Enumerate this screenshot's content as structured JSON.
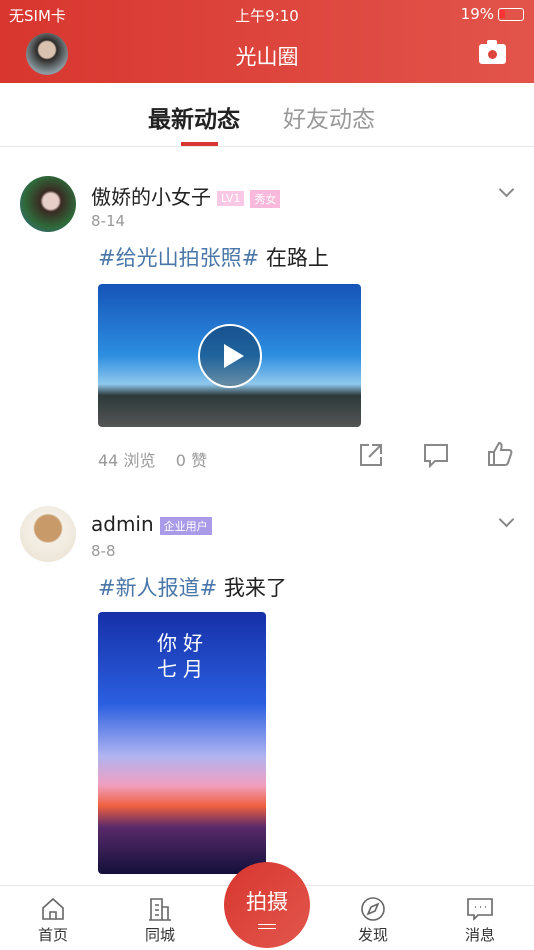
{
  "status": {
    "carrier": "无SIM卡",
    "time": "上午9:10",
    "battery": "19%"
  },
  "header": {
    "title": "光山圈"
  },
  "tabs": [
    {
      "label": "最新动态",
      "active": true
    },
    {
      "label": "好友动态",
      "active": false
    }
  ],
  "posts": [
    {
      "user": "傲娇的小女子",
      "badges": [
        "LV1",
        "秀女"
      ],
      "date": "8-14",
      "tag": "#给光山拍张照#",
      "text": "在路上",
      "media": "video",
      "views": "44 浏览",
      "likes": "0 赞"
    },
    {
      "user": "admin",
      "badges": [
        "企业用户"
      ],
      "date": "8-8",
      "tag": "#新人报道#",
      "text": "我来了",
      "media": "image",
      "poster_title": "你好 七月"
    }
  ],
  "bottom_nav": {
    "items": [
      "首页",
      "同城",
      "发现",
      "消息"
    ],
    "center": "拍摄"
  },
  "colors": {
    "accent": "#d8362f",
    "tag": "#4a77a8",
    "badge_pink": "#f8b9dc",
    "badge_purple": "#a99be8"
  }
}
